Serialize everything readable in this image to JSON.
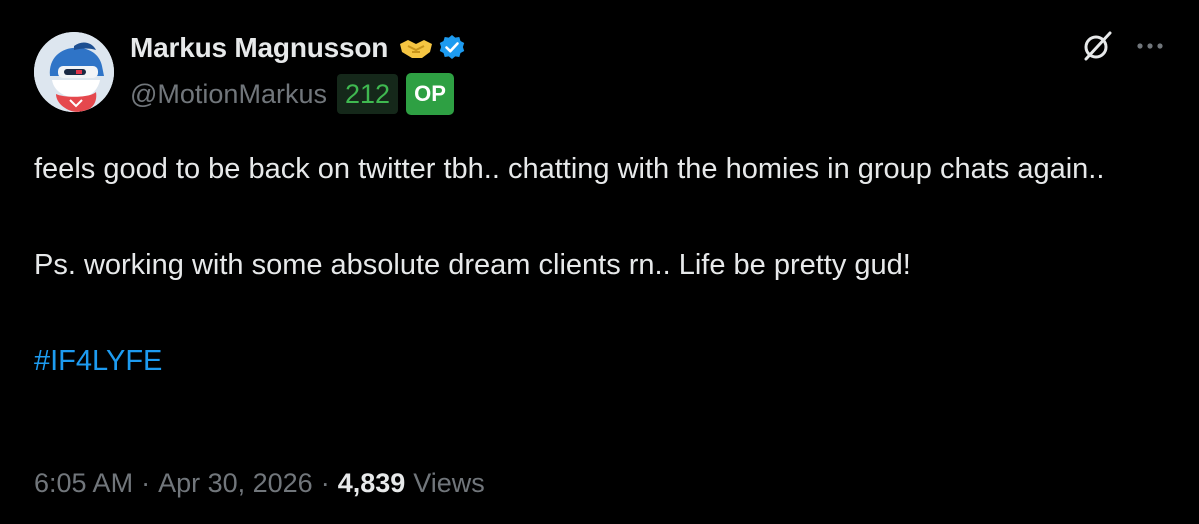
{
  "author": {
    "display_name": "Markus Magnusson",
    "handle": "@MotionMarkus",
    "karma": "212",
    "op_badge": "OP",
    "verified_icon": "verified-badge-icon",
    "emoji_icon": "handshake-emoji-icon",
    "avatar_icon": "avatar",
    "verified_color": "#1d9bf0"
  },
  "header_icons": {
    "grok": "grok-icon",
    "more": "more-icon"
  },
  "tweet": {
    "line1": "feels good to be back on twitter tbh.. chatting with the homies in group chats again..",
    "line2": "Ps. working with some absolute dream clients rn.. Life be pretty gud!",
    "hashtag": "#IF4LYFE",
    "hashtag_color": "#1d9bf0"
  },
  "meta": {
    "time": "6:05 AM",
    "separator": "·",
    "date": "Apr 30, 2026",
    "views_count": "4,839",
    "views_label": "Views"
  },
  "colors": {
    "background": "#000000",
    "primary_text": "#e7e9ea",
    "secondary_text": "#71767b",
    "karma_text": "#3fb950",
    "op_badge_bg": "#2ea043"
  }
}
